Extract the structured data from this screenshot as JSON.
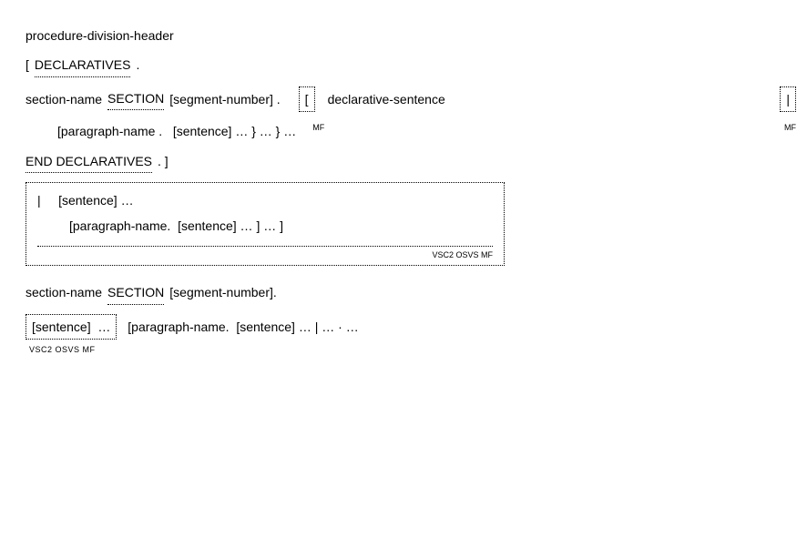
{
  "line1": "procedure-division-header",
  "line2_open": "[",
  "line2_kw": "DECLARATIVES",
  "line2_dot": " .",
  "line3_sec": "section-name ",
  "line3_kw": "SECTION",
  "line3_seg": " [segment-number] .",
  "line3_box_bracket": "[",
  "line3_decl": "declarative-sentence",
  "line3_rbox": "|",
  "line3_mf": "MF",
  "line3_mf2": "MF",
  "line4_para": "[paragraph-name .   [sentence] … } … } …",
  "line4_mf": "MF",
  "line5_kw": "END DECLARATIVES",
  "line5_dot": " . ]",
  "block_a_row1": "|     [sentence] …",
  "block_a_row2": "[paragraph-name.  [sentence] … ] … ]",
  "block_a_dialects": "VSC2   OSVS   MF",
  "line7_sec": "section-name ",
  "line7_kw": "SECTION",
  "line7_seg": " [segment-number].",
  "line8_box": "[sentence]  …",
  "line8_rest": " [paragraph-name.  [sentence] … | … · …",
  "line8_dialects": "VSC2   OSVS   MF"
}
